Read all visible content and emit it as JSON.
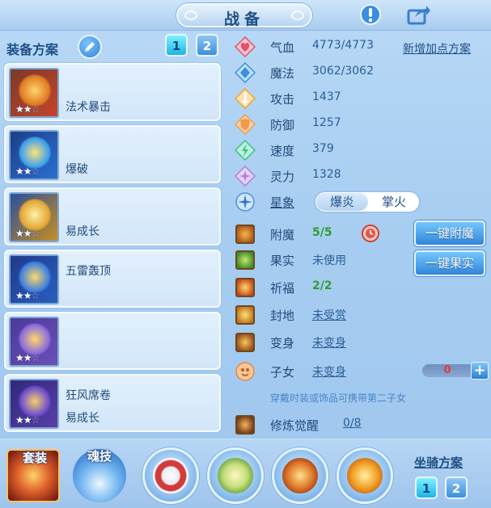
{
  "window": {
    "title": "战备",
    "alert_icon": "exclamation-icon",
    "share_icon": "share-icon"
  },
  "equipment_plans": {
    "title": "装备方案",
    "edit_icon": "pencil-icon",
    "tabs": [
      "1",
      "2"
    ],
    "active_tab": "1",
    "plans": [
      {
        "line1": "",
        "line2": "法术暴击",
        "stars": 2,
        "max_stars": 3,
        "icon": "fire-crown-icon",
        "color": "#c4452a"
      },
      {
        "line1": "",
        "line2": "爆破",
        "stars": 2,
        "max_stars": 3,
        "icon": "blue-helmet-icon",
        "color": "#2b6fd1"
      },
      {
        "line1": "",
        "line2": "易成长",
        "stars": 2,
        "max_stars": 3,
        "icon": "gold-armor-icon",
        "color": "#c88e22"
      },
      {
        "line1": "五雷轰顶",
        "line2": "",
        "stars": 2,
        "max_stars": 3,
        "icon": "crescent-amulet-icon",
        "color": "#2a5fbf"
      },
      {
        "line1": "",
        "line2": "",
        "stars": 2,
        "max_stars": 3,
        "icon": "gold-belt-icon",
        "color": "#6d4fb8"
      },
      {
        "line1": "狂风席卷",
        "line2": "易成长",
        "stars": 2,
        "max_stars": 3,
        "icon": "purple-boots-icon",
        "color": "#5a3ea8"
      }
    ]
  },
  "stats": {
    "hp": {
      "label": "气血",
      "value": "4773/4773",
      "icon": "heart-icon",
      "color": "#e0506a"
    },
    "mp": {
      "label": "魔法",
      "value": "3062/3062",
      "icon": "blue-diamond-icon",
      "color": "#3b8fe0"
    },
    "attack": {
      "label": "攻击",
      "value": "1437",
      "icon": "sword-icon",
      "color": "#f0a626"
    },
    "defense": {
      "label": "防御",
      "value": "1257",
      "icon": "shield-icon",
      "color": "#f09a4a"
    },
    "speed": {
      "label": "速度",
      "value": "379",
      "icon": "lightning-icon",
      "color": "#34c58a"
    },
    "spirit": {
      "label": "灵力",
      "value": "1328",
      "icon": "sparkle-diamond-icon",
      "color": "#b27ae0"
    },
    "add_points_link": "新增加点方案"
  },
  "constellation": {
    "label": "星象",
    "icon": "star-compass-icon",
    "options": [
      "爆炎",
      "掌火"
    ],
    "selected": "爆炎"
  },
  "enchant": {
    "label": "附魔",
    "value": "5/5",
    "icon": "enchant-icon",
    "timer_icon": "clock-icon",
    "button": "一键附魔"
  },
  "fruit": {
    "label": "果实",
    "value": "未使用",
    "icon": "fruit-icon",
    "button": "一键果实"
  },
  "blessing": {
    "label": "祈福",
    "value": "2/2",
    "icon": "blessing-icon"
  },
  "fief": {
    "label": "封地",
    "value": "未受赏",
    "icon": "fief-icon"
  },
  "transform": {
    "label": "变身",
    "value": "未变身",
    "icon": "transform-icon"
  },
  "child": {
    "label": "子女",
    "value": "未变身",
    "icon": "child-icon",
    "stepper_value": "0",
    "plus_label": "+",
    "note": "穿戴时装或饰品可携带第二子女"
  },
  "cultivation": {
    "label": "修炼觉醒",
    "value": "0/8",
    "icon": "cultivation-icon"
  },
  "bottom": {
    "suit_label": "套装",
    "soul_skill_label": "魂技",
    "skills": [
      {
        "icon": "red-swirl-icon",
        "color": "#d23b3b"
      },
      {
        "icon": "green-figure-icon",
        "color": "#9bc24a"
      },
      {
        "icon": "fire-orb-icon",
        "color": "#e0772a"
      },
      {
        "icon": "flame-burst-icon",
        "color": "#f2a024"
      }
    ],
    "mount_title": "坐骑方案",
    "mount_tabs": [
      "1",
      "2"
    ],
    "mount_active": "1"
  }
}
